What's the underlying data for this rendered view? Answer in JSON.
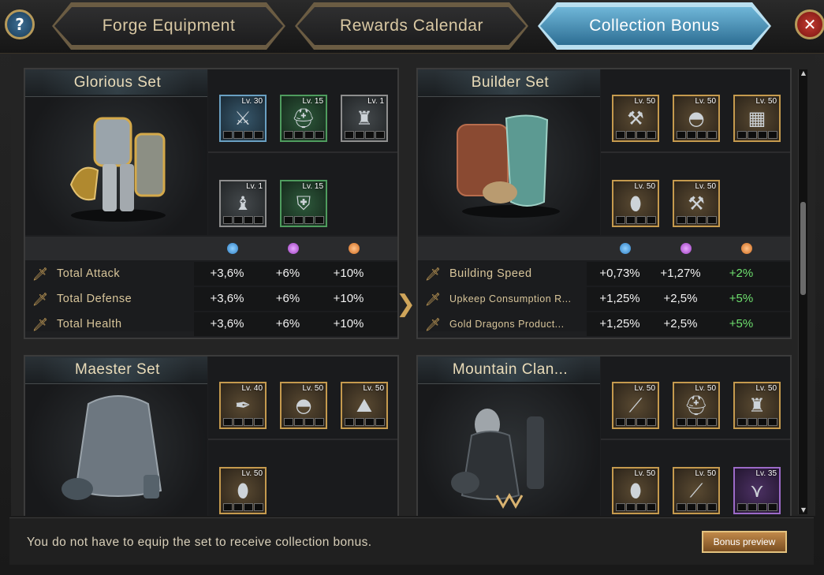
{
  "tabs": [
    {
      "label": "Forge Equipment"
    },
    {
      "label": "Rewards Calendar"
    },
    {
      "label": "Collection Bonus"
    }
  ],
  "active_tab": "Collection Bonus",
  "icons": {
    "help": "question-icon",
    "close": "close-icon",
    "help_glyph": "?",
    "close_glyph": "✕"
  },
  "colors": {
    "accent_gold": "#c59a4e",
    "active_tab": "#6fb6d8",
    "bonus_green": "#6ee06e"
  },
  "sets": [
    {
      "title": "Glorious Set",
      "items": [
        {
          "level": "Lv. 30",
          "rarity": "blue",
          "icon": "sword-icon"
        },
        {
          "level": "Lv. 15",
          "rarity": "green",
          "icon": "helmet-icon"
        },
        {
          "level": "Lv. 1",
          "rarity": "gray",
          "icon": "armor-icon"
        },
        {
          "level": "Lv. 1",
          "rarity": "gray",
          "icon": "greaves-icon"
        },
        {
          "level": "Lv. 15",
          "rarity": "green",
          "icon": "shield-icon"
        }
      ],
      "stats": [
        {
          "label": "Total Attack",
          "values": [
            "+3,6%",
            "+6%",
            "+10%"
          ]
        },
        {
          "label": "Total Defense",
          "values": [
            "+3,6%",
            "+6%",
            "+10%"
          ]
        },
        {
          "label": "Total Health",
          "values": [
            "+3,6%",
            "+6%",
            "+10%"
          ]
        }
      ]
    },
    {
      "title": "Builder Set",
      "items": [
        {
          "level": "Lv. 50",
          "rarity": "gold",
          "icon": "tools-icon"
        },
        {
          "level": "Lv. 50",
          "rarity": "gold",
          "icon": "cap-icon"
        },
        {
          "level": "Lv. 50",
          "rarity": "gold",
          "icon": "vest-icon"
        },
        {
          "level": "Lv. 50",
          "rarity": "gold",
          "icon": "trousers-icon"
        },
        {
          "level": "Lv. 50",
          "rarity": "gold",
          "icon": "hammer-icon"
        }
      ],
      "stats": [
        {
          "label": "Building Speed",
          "values": [
            "+0,73%",
            "+1,27%",
            "+2%"
          ]
        },
        {
          "label": "Upkeep Consumption R...",
          "values": [
            "+1,25%",
            "+2,5%",
            "+5%"
          ]
        },
        {
          "label": "Gold Dragons Product...",
          "values": [
            "+1,25%",
            "+2,5%",
            "+5%"
          ]
        }
      ]
    },
    {
      "title": "Maester Set",
      "items": [
        {
          "level": "Lv. 40",
          "rarity": "gold",
          "icon": "quill-icon"
        },
        {
          "level": "Lv. 50",
          "rarity": "gold",
          "icon": "hood-icon"
        },
        {
          "level": "Lv. 50",
          "rarity": "gold",
          "icon": "robe-icon"
        },
        {
          "level": "Lv. 50",
          "rarity": "gold",
          "icon": "boots-icon"
        }
      ]
    },
    {
      "title": "Mountain Clan...",
      "items": [
        {
          "level": "Lv. 50",
          "rarity": "gold",
          "icon": "spear-icon"
        },
        {
          "level": "Lv. 50",
          "rarity": "gold",
          "icon": "helmet-icon"
        },
        {
          "level": "Lv. 50",
          "rarity": "gold",
          "icon": "fur-armor-icon"
        },
        {
          "level": "Lv. 50",
          "rarity": "gold",
          "icon": "leggings-icon"
        },
        {
          "level": "Lv. 50",
          "rarity": "gold",
          "icon": "belt-icon"
        },
        {
          "level": "Lv. 35",
          "rarity": "purple",
          "icon": "claw-icon"
        }
      ]
    }
  ],
  "footer": {
    "note": "You do not have to equip the set to receive collection bonus.",
    "preview_button": "Bonus preview"
  }
}
